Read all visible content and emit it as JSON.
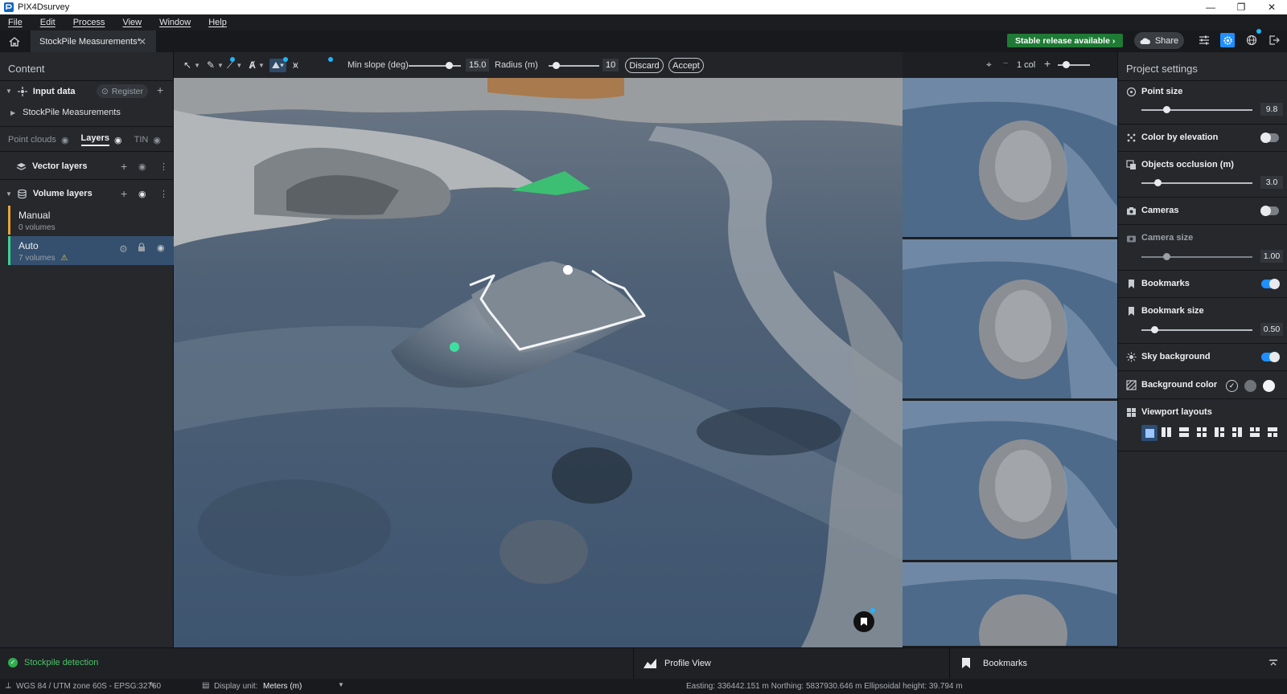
{
  "window": {
    "title": "PIX4Dsurvey",
    "controls": [
      "—",
      "❐",
      "✕"
    ]
  },
  "menu": [
    "File",
    "Edit",
    "Process",
    "View",
    "Window",
    "Help"
  ],
  "tab": {
    "label": "StockPile Measurements*"
  },
  "header": {
    "stable_release": "Stable release available  ›",
    "share": "Share"
  },
  "left_panel": {
    "title": "Content",
    "input_data": {
      "label": "Input data",
      "register": "Register",
      "child": "StockPile Measurements"
    },
    "tabs": {
      "point_clouds": "Point clouds",
      "layers": "Layers",
      "tin": "TIN"
    },
    "vector_layers": "Vector layers",
    "volume_layers": "Volume layers",
    "items": [
      {
        "name": "Manual",
        "count": "0 volumes",
        "color": "#e8a33b"
      },
      {
        "name": "Auto",
        "count": "7 volumes",
        "color": "#3ecf8e"
      }
    ]
  },
  "toolbar": {
    "min_slope_label": "Min slope (deg)",
    "min_slope_value": "15.0",
    "min_slope_fraction": 0.78,
    "radius_label": "Radius (m)",
    "radius_value": "10",
    "radius_fraction": 0.15,
    "discard": "Discard",
    "accept": "Accept"
  },
  "thumbnail_bar": {
    "columns": "1 col"
  },
  "right_panel": {
    "title": "Project settings",
    "point_size": {
      "label": "Point size",
      "value": "9.8",
      "fraction": 0.23
    },
    "color_by_elevation": {
      "label": "Color by elevation",
      "on": false
    },
    "objects_occlusion": {
      "label": "Objects occlusion (m)",
      "value": "3.0",
      "fraction": 0.15
    },
    "cameras": {
      "label": "Cameras",
      "on": false
    },
    "camera_size": {
      "label": "Camera size",
      "value": "1.00",
      "fraction": 0.23
    },
    "bookmarks": {
      "label": "Bookmarks",
      "on": true
    },
    "bookmark_size": {
      "label": "Bookmark size",
      "value": "0.50",
      "fraction": 0.12
    },
    "sky_background": {
      "label": "Sky background",
      "on": true
    },
    "background_color": {
      "label": "Background color"
    },
    "viewport_layouts": {
      "label": "Viewport layouts"
    }
  },
  "dock": {
    "stockpile": "Stockpile detection",
    "profile": "Profile View",
    "bookmarks": "Bookmarks"
  },
  "status": {
    "crs": "WGS 84 / UTM zone 60S - EPSG:32760",
    "display_unit_label": "Display unit:",
    "display_unit_value": "Meters (m)",
    "coords": "Easting: 336442.151 m  Northing: 5837930.646 m  Ellipsoidal height: 39.794 m"
  },
  "colors": {
    "accent": "#1f8fff",
    "success": "#1f7a35",
    "auto_layer": "#3ecf8e",
    "manual_layer": "#e8a33b"
  }
}
